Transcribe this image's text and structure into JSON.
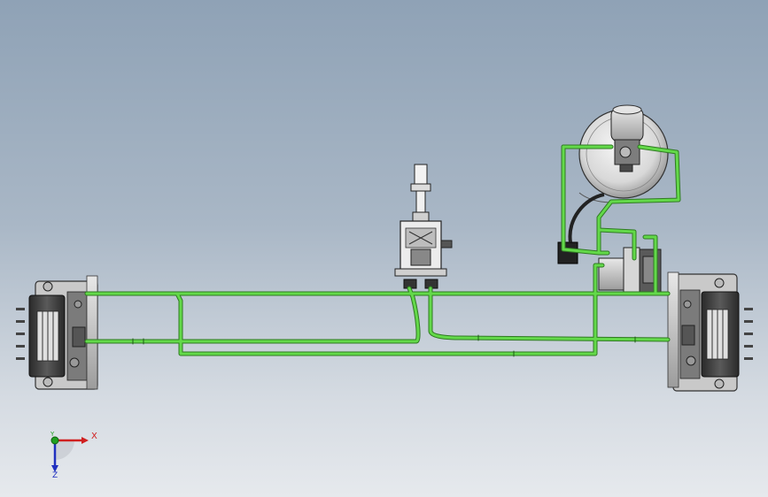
{
  "viewport": {
    "background_top": "#8fa2b6",
    "background_bottom": "#e6e9ed"
  },
  "model": {
    "pipe_color": "#63d94a",
    "pipe_outline": "#2f7a22",
    "part_color": "#3a3a3a",
    "components": [
      {
        "name": "left-brake-assembly"
      },
      {
        "name": "right-brake-assembly"
      },
      {
        "name": "brake-pedal-assembly"
      },
      {
        "name": "vacuum-booster"
      },
      {
        "name": "master-cylinder"
      },
      {
        "name": "proportioning-valve"
      },
      {
        "name": "brake-lines"
      }
    ]
  },
  "triad": {
    "x_label": "X",
    "y_label": "Y",
    "z_label": "Z",
    "x_color": "#d02020",
    "y_color": "#20a020",
    "z_color": "#2030c0"
  }
}
